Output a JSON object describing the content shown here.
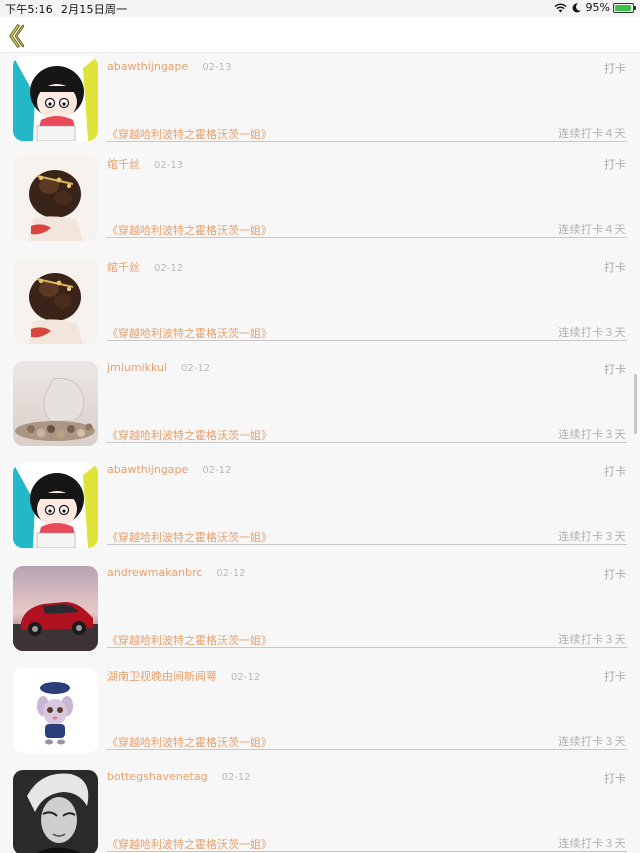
{
  "status_bar": {
    "time": "下午5:16",
    "date": "2月15日周一",
    "battery_pct": "95%",
    "battery_level": 0.95
  },
  "nav": {
    "back_icon": "chevron-left-icon",
    "accent": "#c9b42a"
  },
  "colors": {
    "username": "#e5a06c",
    "book": "#e5a06c",
    "meta": "#b1b1b1"
  },
  "items": [
    {
      "user": "abawthijngape",
      "date": "02-13",
      "action": "打卡",
      "book": "《穿越哈利波特之霍格沃茨一姐》",
      "streak": "连续打卡４天",
      "avatar": "cartoon-girl"
    },
    {
      "user": "绾千丝",
      "date": "02-13",
      "action": "打卡",
      "book": "《穿越哈利波特之霍格沃茨一姐》",
      "streak": "连续打卡４天",
      "avatar": "hair-ornament"
    },
    {
      "user": "绾千丝",
      "date": "02-12",
      "action": "打卡",
      "book": "《穿越哈利波特之霍格沃茨一姐》",
      "streak": "连续打卡３天",
      "avatar": "hair-ornament"
    },
    {
      "user": "jmiumikkul",
      "date": "02-12",
      "action": "打卡",
      "book": "《穿越哈利波特之霍格沃茨一姐》",
      "streak": "连续打卡３天",
      "avatar": "still-life"
    },
    {
      "user": "abawthijngape",
      "date": "02-12",
      "action": "打卡",
      "book": "《穿越哈利波特之霍格沃茨一姐》",
      "streak": "连续打卡３天",
      "avatar": "cartoon-girl"
    },
    {
      "user": "andrewmakanbrc",
      "date": "02-12",
      "action": "打卡",
      "book": "《穿越哈利波特之霍格沃茨一姐》",
      "streak": "连续打卡３天",
      "avatar": "red-car"
    },
    {
      "user": "湖南卫视晚由间新闻萼",
      "date": "02-12",
      "action": "打卡",
      "book": "《穿越哈利波特之霍格沃茨一姐》",
      "streak": "连续打卡３天",
      "avatar": "cartoon-bunny"
    },
    {
      "user": "bottegshavenetag",
      "date": "02-12",
      "action": "打卡",
      "book": "《穿越哈利波特之霍格沃茨一姐》",
      "streak": "连续打卡３天",
      "avatar": "bw-portrait"
    }
  ]
}
